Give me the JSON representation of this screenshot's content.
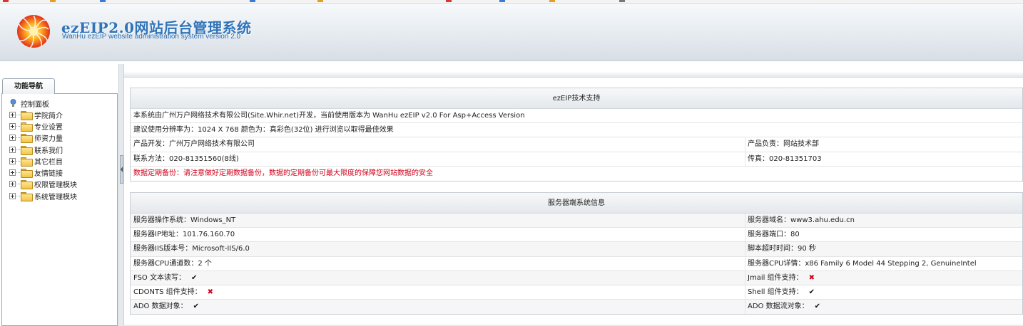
{
  "header": {
    "title": "ezEIP2.0网站后台管理系统",
    "subtitle": "WanHu ezEIP website administration system version 2.0"
  },
  "sidebar": {
    "tab_label": "功能导航",
    "root_label": "控制面板",
    "items": [
      {
        "label": "学院简介"
      },
      {
        "label": "专业设置"
      },
      {
        "label": "师资力量"
      },
      {
        "label": "联系我们"
      },
      {
        "label": "其它栏目"
      },
      {
        "label": "友情链接"
      },
      {
        "label": "权限管理模块"
      },
      {
        "label": "系统管理模块"
      }
    ]
  },
  "support": {
    "title": "ezEIP技术支持",
    "line1": "本系统由广州万户网络技术有限公司(Site.Whir.net)开发，当前使用版本为 WanHu ezEIP v2.0 For Asp+Access Version",
    "line2": "建议使用分辨率为：1024 X 768 颜色为：真彩色(32位) 进行浏览以取得最佳效果",
    "developer": "产品开发：广州万户网络技术有限公司",
    "owner": "产品负责：网站技术部",
    "contact": "联系方法：020-81351560(8线)",
    "fax": "传真：020-81351703",
    "warning": "数据定期备份：请注意做好定期数据备份，数据的定期备份可最大限度的保障您网站数据的安全"
  },
  "server": {
    "title": "服务器端系统信息",
    "os": "服务器操作系统：Windows_NT",
    "domain": "服务器域名：www3.ahu.edu.cn",
    "ip": "服务器IP地址：101.76.160.70",
    "port": "服务器端口：80",
    "iis": "服务器IIS版本号：Microsoft-IIS/6.0",
    "timeout": "脚本超时时间：90 秒",
    "cpu_count": "服务器CPU通道数：2 个",
    "cpu_detail": "服务器CPU详情：x86 Family 6 Model 44 Stepping 2, GenuineIntel",
    "fso_label": "FSO 文本读写：",
    "fso_mark": "✔",
    "jmail_label": "Jmail 组件支持：",
    "jmail_mark": "✖",
    "cdonts_label": "CDONTS 组件支持：",
    "cdonts_mark": "✖",
    "shell_label": "Shell 组件支持：",
    "shell_mark": "✔",
    "ado_label": "ADO 数据对象：",
    "ado_mark": "✔",
    "adostream_label": "ADO 数据流对象：",
    "adostream_mark": "✔"
  },
  "colors": {
    "accent": "#2f73b8",
    "warning": "#d0021b"
  },
  "icons": [
    "sunburst-logo-icon",
    "control-panel-icon",
    "plus-expander-icon",
    "folder-icon",
    "collapse-arrow-icon",
    "check-icon",
    "cross-icon"
  ]
}
